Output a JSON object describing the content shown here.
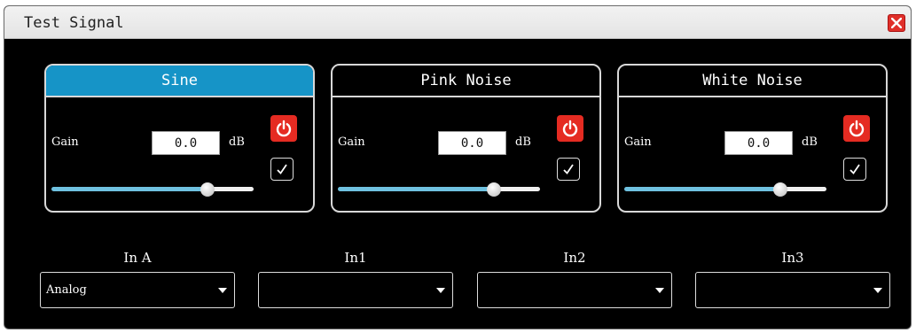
{
  "window": {
    "title": "Test Signal"
  },
  "generators": [
    {
      "name": "Sine",
      "active": true,
      "gain_label": "Gain",
      "gain_value": "0.0",
      "unit": "dB",
      "slider_level": 0.77
    },
    {
      "name": "Pink Noise",
      "active": false,
      "gain_label": "Gain",
      "gain_value": "0.0",
      "unit": "dB",
      "slider_level": 0.77
    },
    {
      "name": "White Noise",
      "active": false,
      "gain_label": "Gain",
      "gain_value": "0.0",
      "unit": "dB",
      "slider_level": 0.77
    }
  ],
  "inputs": [
    {
      "label": "In A",
      "value": "Analog"
    },
    {
      "label": "In1",
      "value": ""
    },
    {
      "label": "In2",
      "value": ""
    },
    {
      "label": "In3",
      "value": ""
    }
  ],
  "colors": {
    "accent": "#1694c7",
    "power": "#e52b22",
    "slider_fill": "#6fc1e0"
  },
  "icons": {
    "close": "close-icon",
    "power": "power-icon",
    "check": "check-icon",
    "dropdown": "chevron-down-icon"
  }
}
